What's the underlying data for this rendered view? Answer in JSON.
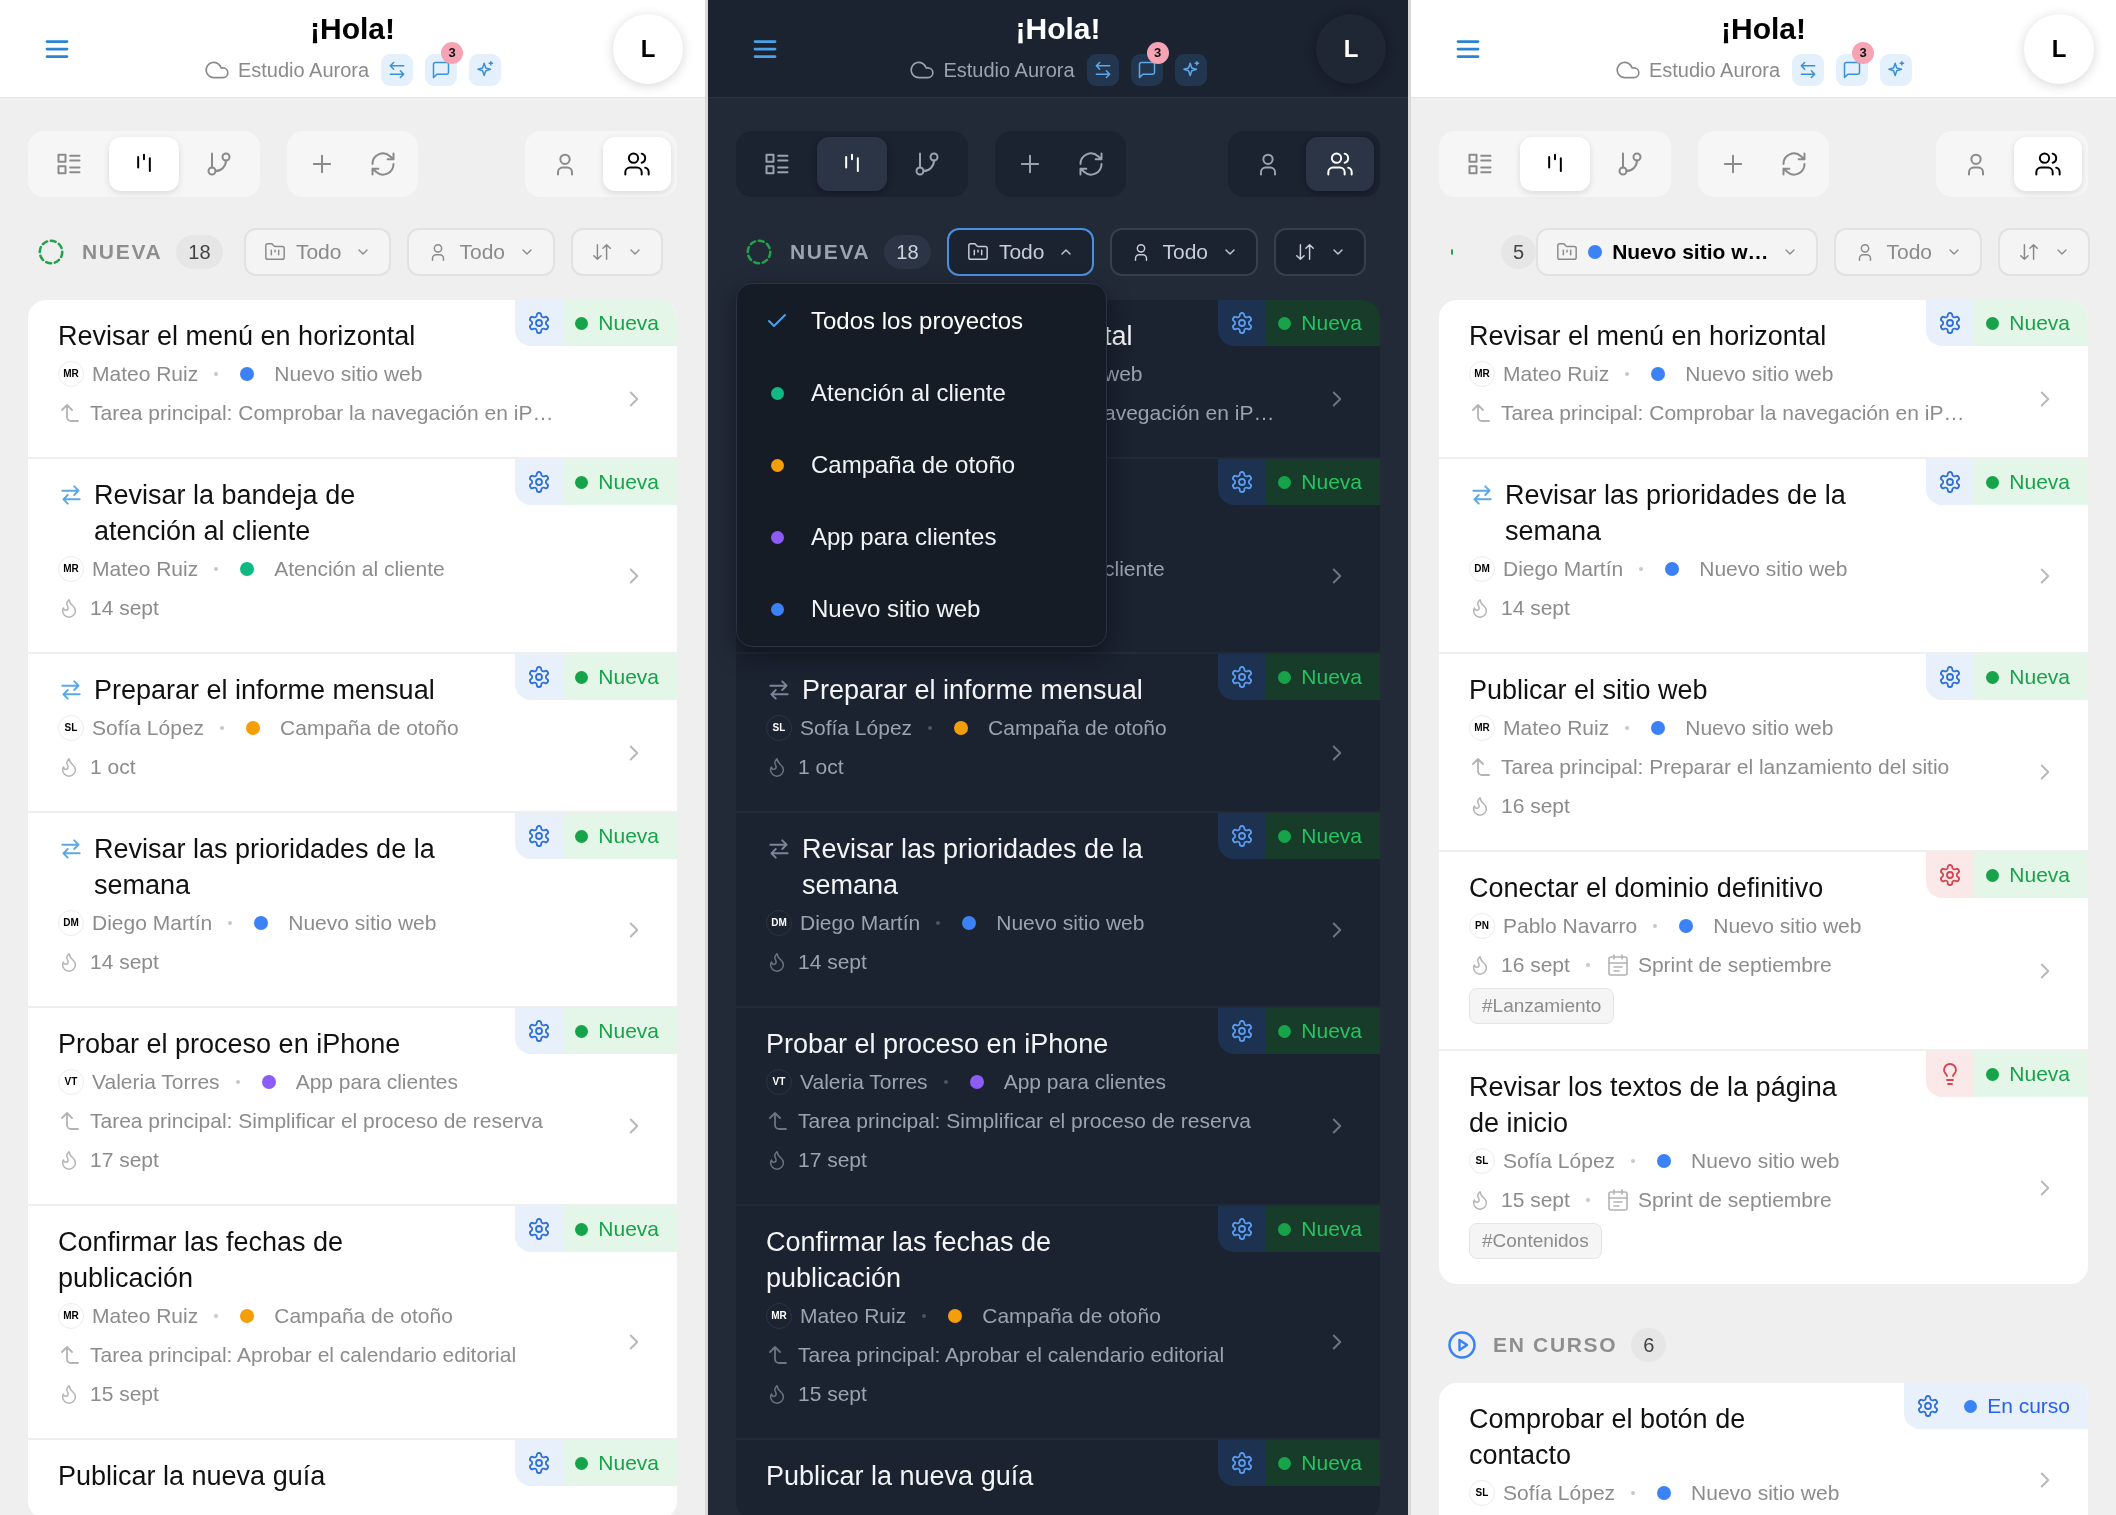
{
  "panels": [
    {
      "kind": "light",
      "header": {
        "title": "¡Hola!",
        "workspace": "Estudio Aurora",
        "notifications": "3",
        "avatar": "L"
      },
      "toolbar": {
        "views": [
          {
            "kind": "list",
            "selected": false
          },
          {
            "kind": "board",
            "selected": true
          },
          {
            "kind": "flow",
            "selected": false
          }
        ],
        "actions": [
          {
            "kind": "add"
          },
          {
            "kind": "refresh"
          }
        ],
        "scopes": [
          {
            "kind": "me",
            "selected": false
          },
          {
            "kind": "team",
            "selected": true
          }
        ]
      },
      "filters": [
        {
          "kind": "project",
          "label": "Todo",
          "expanded": false
        },
        {
          "kind": "assignee",
          "label": "Todo",
          "expanded": false
        },
        {
          "kind": "sort",
          "expanded": false
        }
      ],
      "groups": [
        {
          "kind": "new",
          "label": "NUEVA",
          "count": "18",
          "cards": [
            {
              "title": "Revisar el menú en horizontal",
              "recurring": false,
              "priority": {
                "kind": "gear",
                "urgent": false
              },
              "status": {
                "label": "Nueva",
                "kind": "new"
              },
              "assignee": {
                "initials": "MR",
                "name": "Mateo Ruiz"
              },
              "project": {
                "name": "Nuevo sitio web",
                "color": "#3b82f6"
              },
              "parent": "Tarea principal: Comprobar la navegación en iP…"
            },
            {
              "title": "Revisar la bandeja de atención al cliente",
              "recurring": true,
              "priority": {
                "kind": "gear",
                "urgent": false
              },
              "status": {
                "label": "Nueva",
                "kind": "new"
              },
              "assignee": {
                "initials": "MR",
                "name": "Mateo Ruiz"
              },
              "project": {
                "name": "Atención al cliente",
                "color": "#10b981"
              },
              "date": "14 sept"
            },
            {
              "title": "Preparar el informe mensual",
              "recurring": true,
              "priority": {
                "kind": "gear",
                "urgent": false
              },
              "status": {
                "label": "Nueva",
                "kind": "new"
              },
              "assignee": {
                "initials": "SL",
                "name": "Sofía López"
              },
              "project": {
                "name": "Campaña de otoño",
                "color": "#f59e0b"
              },
              "date": "1 oct"
            },
            {
              "title": "Revisar las prioridades de la semana",
              "recurring": true,
              "priority": {
                "kind": "gear",
                "urgent": false
              },
              "status": {
                "label": "Nueva",
                "kind": "new"
              },
              "assignee": {
                "initials": "DM",
                "name": "Diego Martín"
              },
              "project": {
                "name": "Nuevo sitio web",
                "color": "#3b82f6"
              },
              "date": "14 sept"
            },
            {
              "title": "Probar el proceso en iPhone",
              "recurring": false,
              "priority": {
                "kind": "gear",
                "urgent": false
              },
              "status": {
                "label": "Nueva",
                "kind": "new"
              },
              "assignee": {
                "initials": "VT",
                "name": "Valeria Torres"
              },
              "project": {
                "name": "App para clientes",
                "color": "#8b5cf6"
              },
              "parent": "Tarea principal: Simplificar el proceso de reserva",
              "date": "17 sept"
            },
            {
              "title": "Confirmar las fechas de publicación",
              "recurring": false,
              "priority": {
                "kind": "gear",
                "urgent": false
              },
              "status": {
                "label": "Nueva",
                "kind": "new"
              },
              "assignee": {
                "initials": "MR",
                "name": "Mateo Ruiz"
              },
              "project": {
                "name": "Campaña de otoño",
                "color": "#f59e0b"
              },
              "parent": "Tarea principal: Aprobar el calendario editorial",
              "date": "15 sept"
            },
            {
              "title": "Publicar la nueva guía",
              "recurring": false,
              "priority": {
                "kind": "gear",
                "urgent": false
              },
              "status": {
                "label": "Nueva",
                "kind": "new"
              }
            }
          ]
        }
      ]
    },
    {
      "kind": "dark",
      "header": {
        "title": "¡Hola!",
        "workspace": "Estudio Aurora",
        "notifications": "3",
        "avatar": "L"
      },
      "toolbar": {
        "views": [
          {
            "kind": "list",
            "selected": false
          },
          {
            "kind": "board",
            "selected": true
          },
          {
            "kind": "flow",
            "selected": false
          }
        ],
        "actions": [
          {
            "kind": "add"
          },
          {
            "kind": "refresh"
          }
        ],
        "scopes": [
          {
            "kind": "me",
            "selected": false
          },
          {
            "kind": "team",
            "selected": true
          }
        ]
      },
      "filters": [
        {
          "kind": "project",
          "label": "Todo",
          "expanded": true
        },
        {
          "kind": "assignee",
          "label": "Todo",
          "expanded": false
        },
        {
          "kind": "sort",
          "expanded": false
        }
      ],
      "dropdown": {
        "items": [
          {
            "label": "Todos los proyectos",
            "selected": true
          },
          {
            "label": "Atención al cliente",
            "selected": false,
            "color": "#10b981"
          },
          {
            "label": "Campaña de otoño",
            "selected": false,
            "color": "#f59e0b"
          },
          {
            "label": "App para clientes",
            "selected": false,
            "color": "#8b5cf6"
          },
          {
            "label": "Nuevo sitio web",
            "selected": false,
            "color": "#3b82f6"
          }
        ]
      },
      "groups": [
        {
          "kind": "new",
          "label": "NUEVA",
          "count": "18",
          "cards": [
            {
              "partial": true,
              "priority": {
                "kind": "gear",
                "urgent": false
              },
              "status": {
                "label": "Nueva",
                "kind": "new"
              },
              "lines": [
                {
                  "kind": "title",
                  "text": "tal"
                },
                {
                  "kind": "meta",
                  "text": "web"
                },
                {
                  "kind": "parent",
                  "text": "avegación en iP…"
                }
              ]
            },
            {
              "partial": true,
              "priority": {
                "kind": "gear",
                "urgent": false
              },
              "status": {
                "label": "Nueva",
                "kind": "new"
              },
              "lines": [
                {
                  "kind": "hidden_title"
                },
                {
                  "kind": "hidden_title"
                },
                {
                  "kind": "meta",
                  "text": "cliente"
                },
                {
                  "kind": "hidden"
                }
              ]
            },
            {
              "title": "Preparar el informe mensual",
              "recurring": true,
              "priority": {
                "kind": "gear",
                "urgent": false
              },
              "status": {
                "label": "Nueva",
                "kind": "new"
              },
              "assignee": {
                "initials": "SL",
                "name": "Sofía López"
              },
              "project": {
                "name": "Campaña de otoño",
                "color": "#f59e0b"
              },
              "date": "1 oct"
            },
            {
              "title": "Revisar las prioridades de la semana",
              "recurring": true,
              "priority": {
                "kind": "gear",
                "urgent": false
              },
              "status": {
                "label": "Nueva",
                "kind": "new"
              },
              "assignee": {
                "initials": "DM",
                "name": "Diego Martín"
              },
              "project": {
                "name": "Nuevo sitio web",
                "color": "#3b82f6"
              },
              "date": "14 sept"
            },
            {
              "title": "Probar el proceso en iPhone",
              "recurring": false,
              "priority": {
                "kind": "gear",
                "urgent": false
              },
              "status": {
                "label": "Nueva",
                "kind": "new"
              },
              "assignee": {
                "initials": "VT",
                "name": "Valeria Torres"
              },
              "project": {
                "name": "App para clientes",
                "color": "#8b5cf6"
              },
              "parent": "Tarea principal: Simplificar el proceso de reserva",
              "date": "17 sept"
            },
            {
              "title": "Confirmar las fechas de publicación",
              "recurring": false,
              "priority": {
                "kind": "gear",
                "urgent": false
              },
              "status": {
                "label": "Nueva",
                "kind": "new"
              },
              "assignee": {
                "initials": "MR",
                "name": "Mateo Ruiz"
              },
              "project": {
                "name": "Campaña de otoño",
                "color": "#f59e0b"
              },
              "parent": "Tarea principal: Aprobar el calendario editorial",
              "date": "15 sept"
            },
            {
              "title": "Publicar la nueva guía",
              "recurring": false,
              "priority": {
                "kind": "gear",
                "urgent": false
              },
              "status": {
                "label": "Nueva",
                "kind": "new"
              }
            }
          ]
        }
      ]
    },
    {
      "kind": "light",
      "header": {
        "title": "¡Hola!",
        "workspace": "Estudio Aurora",
        "notifications": "3",
        "avatar": "L"
      },
      "toolbar": {
        "views": [
          {
            "kind": "list",
            "selected": false
          },
          {
            "kind": "board",
            "selected": true
          },
          {
            "kind": "flow",
            "selected": false
          }
        ],
        "actions": [
          {
            "kind": "add"
          },
          {
            "kind": "refresh"
          }
        ],
        "scopes": [
          {
            "kind": "me",
            "selected": false
          },
          {
            "kind": "team",
            "selected": true
          }
        ]
      },
      "filters": [
        {
          "kind": "project",
          "label": "Nuevo sitio w…",
          "color": "#3b82f6",
          "expanded": false
        },
        {
          "kind": "assignee",
          "label": "Todo",
          "expanded": false
        },
        {
          "kind": "sort",
          "expanded": false
        }
      ],
      "groups": [
        {
          "kind": "new",
          "count": "5",
          "cards": [
            {
              "title": "Revisar el menú en horizontal",
              "recurring": false,
              "priority": {
                "kind": "gear",
                "urgent": false
              },
              "status": {
                "label": "Nueva",
                "kind": "new"
              },
              "assignee": {
                "initials": "MR",
                "name": "Mateo Ruiz"
              },
              "project": {
                "name": "Nuevo sitio web",
                "color": "#3b82f6"
              },
              "parent": "Tarea principal: Comprobar la navegación en iP…"
            },
            {
              "title": "Revisar las prioridades de la semana",
              "recurring": true,
              "priority": {
                "kind": "gear",
                "urgent": false
              },
              "status": {
                "label": "Nueva",
                "kind": "new"
              },
              "assignee": {
                "initials": "DM",
                "name": "Diego Martín"
              },
              "project": {
                "name": "Nuevo sitio web",
                "color": "#3b82f6"
              },
              "date": "14 sept"
            },
            {
              "title": "Publicar el sitio web",
              "recurring": false,
              "priority": {
                "kind": "gear",
                "urgent": false
              },
              "status": {
                "label": "Nueva",
                "kind": "new"
              },
              "assignee": {
                "initials": "MR",
                "name": "Mateo Ruiz"
              },
              "project": {
                "name": "Nuevo sitio web",
                "color": "#3b82f6"
              },
              "parent": "Tarea principal: Preparar el lanzamiento del sitio",
              "date": "16 sept"
            },
            {
              "title": "Conectar el dominio definitivo",
              "recurring": false,
              "priority": {
                "kind": "gear",
                "urgent": true
              },
              "status": {
                "label": "Nueva",
                "kind": "new"
              },
              "assignee": {
                "initials": "PN",
                "name": "Pablo Navarro"
              },
              "project": {
                "name": "Nuevo sitio web",
                "color": "#3b82f6"
              },
              "date": "16 sept",
              "sprint": "Sprint de septiembre",
              "tag": "#Lanzamiento"
            },
            {
              "title": "Revisar los textos de la página de inicio",
              "recurring": false,
              "priority": {
                "kind": "bulb",
                "urgent": true
              },
              "status": {
                "label": "Nueva",
                "kind": "new"
              },
              "assignee": {
                "initials": "SL",
                "name": "Sofía López"
              },
              "project": {
                "name": "Nuevo sitio web",
                "color": "#3b82f6"
              },
              "date": "15 sept",
              "sprint": "Sprint de septiembre",
              "tag": "#Contenidos"
            }
          ]
        },
        {
          "kind": "in_progress",
          "label": "EN CURSO",
          "count": "6",
          "cards": [
            {
              "title": "Comprobar el botón de contacto",
              "recurring": false,
              "priority": {
                "kind": "gear",
                "urgent": false
              },
              "status": {
                "label": "En curso",
                "kind": "in_progress"
              },
              "assignee": {
                "initials": "SL",
                "name": "Sofía López"
              },
              "project": {
                "name": "Nuevo sitio web",
                "color": "#3b82f6"
              }
            }
          ]
        }
      ]
    }
  ]
}
